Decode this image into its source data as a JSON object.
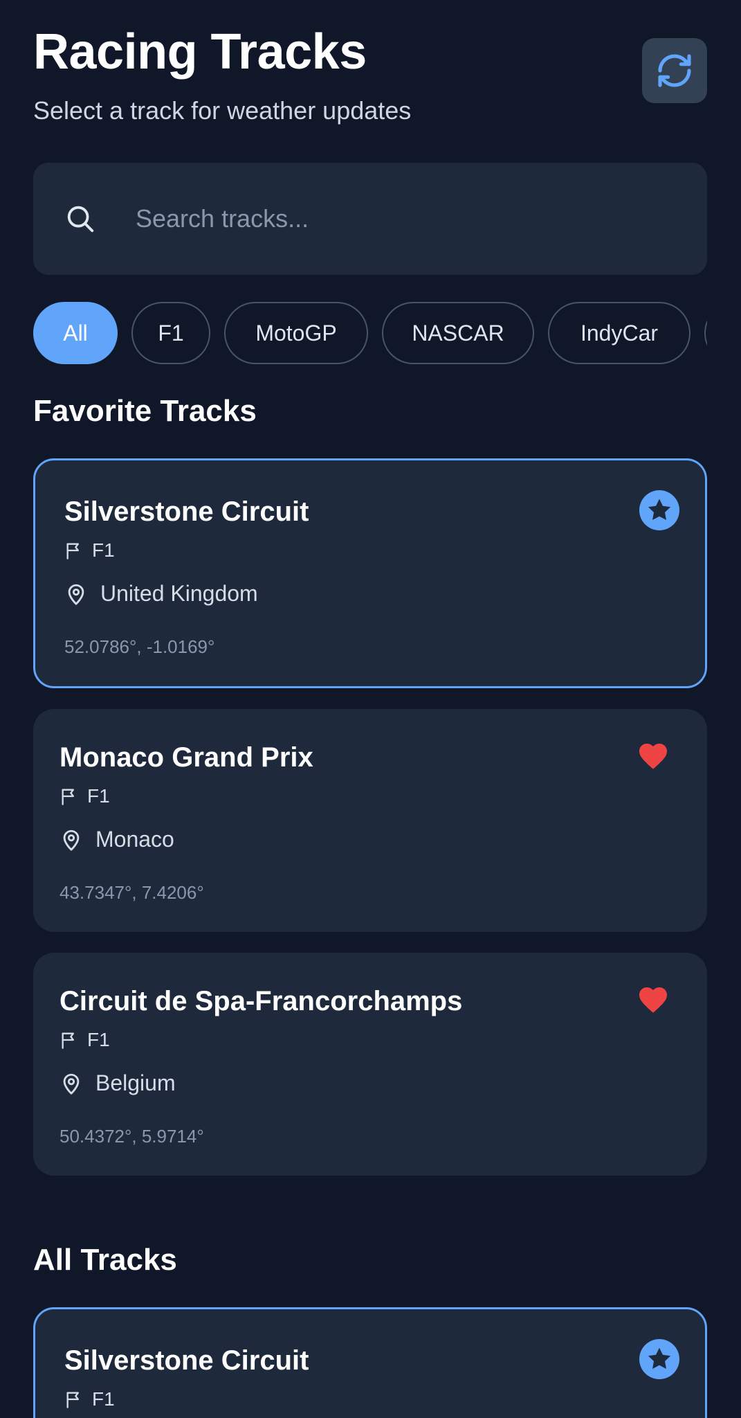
{
  "header": {
    "title": "Racing Tracks",
    "subtitle": "Select a track for weather updates",
    "refresh_icon": "refresh-icon"
  },
  "search": {
    "placeholder": "Search tracks...",
    "icon": "search-icon"
  },
  "filters": {
    "items": [
      "All",
      "F1",
      "MotoGP",
      "NASCAR",
      "IndyCar"
    ],
    "selected": "All"
  },
  "favorites": {
    "title": "Favorite Tracks",
    "tracks": [
      {
        "name": "Silverstone Circuit",
        "category": "F1",
        "country": "United Kingdom",
        "coords": "52.0786°, -1.0169°",
        "badge_icon": "star-icon",
        "selected": true
      },
      {
        "name": "Monaco Grand Prix",
        "category": "F1",
        "country": "Monaco",
        "coords": "43.7347°, 7.4206°",
        "badge_icon": "heart-icon",
        "selected": false
      },
      {
        "name": "Circuit de Spa-Francorchamps",
        "category": "F1",
        "country": "Belgium",
        "coords": "50.4372°, 5.9714°",
        "badge_icon": "heart-icon",
        "selected": false
      }
    ]
  },
  "all_tracks": {
    "title": "All Tracks",
    "tracks": [
      {
        "name": "Silverstone Circuit",
        "category": "F1",
        "badge_icon": "star-icon",
        "selected": true
      }
    ]
  },
  "colors": {
    "background": "#0f1729",
    "card": "#1e293b",
    "accent": "#60a5fa",
    "favorite_heart": "#ef4444"
  }
}
